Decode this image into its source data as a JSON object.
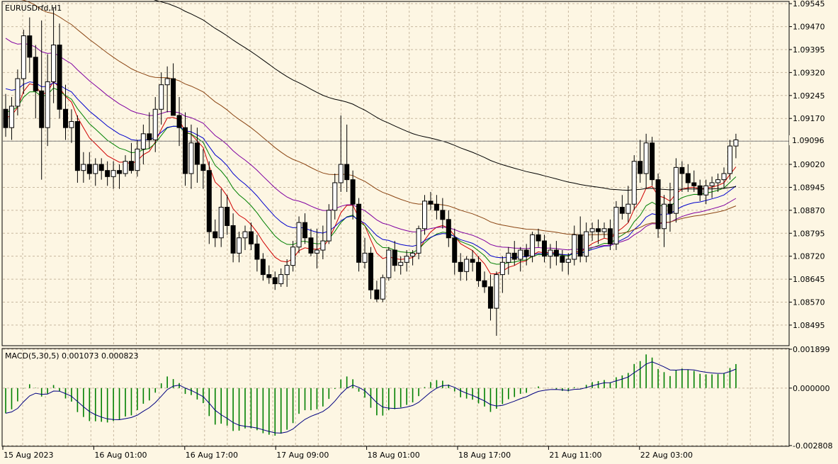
{
  "chart_data": {
    "type": "candlestick",
    "symbol_label": "EURUSDrfd,H1",
    "current_price_label": "1.09096",
    "current_price": 1.09096,
    "colors": {
      "background": "#fdf6e3",
      "grid": "#c8b8a0",
      "bull_body": "#ffffff",
      "bear_body": "#000000",
      "ema_fast": "#d00000",
      "ema_mid": "#008000",
      "ema_blue": "#0000cc",
      "ema_purple": "#8000a0",
      "ema_brown": "#8b4513",
      "ema_black": "#000000",
      "macd_hist": "#008000",
      "macd_signal": "#000080",
      "current_line": "#808080"
    },
    "price_axis": {
      "min": 1.0843,
      "max": 1.0955,
      "ticks": [
        "1.09545",
        "1.09470",
        "1.09395",
        "1.09320",
        "1.09245",
        "1.09170",
        "1.09020",
        "1.08945",
        "1.08870",
        "1.08795",
        "1.08720",
        "1.08645",
        "1.08570",
        "1.08495"
      ]
    },
    "time_labels": [
      "15 Aug 2023",
      "16 Aug 01:00",
      "16 Aug 17:00",
      "17 Aug 09:00",
      "18 Aug 01:00",
      "18 Aug 17:00",
      "21 Aug 11:00",
      "22 Aug 03:00"
    ],
    "macd": {
      "label": "MACD(5,30,5) 0.001073 0.000823",
      "axis_ticks": [
        "0.001899",
        "0.000000",
        "-0.002808"
      ],
      "min": -0.002808,
      "max": 0.001899
    },
    "candles": [
      [
        1.092,
        1.0925,
        1.0911,
        1.0914
      ],
      [
        1.0914,
        1.0924,
        1.091,
        1.0921
      ],
      [
        1.0921,
        1.0933,
        1.0918,
        1.093
      ],
      [
        1.093,
        1.0946,
        1.0925,
        1.0944
      ],
      [
        1.0944,
        1.095,
        1.0932,
        1.0937
      ],
      [
        1.0937,
        1.0941,
        1.0917,
        1.0926
      ],
      [
        1.0926,
        1.0949,
        1.0897,
        1.0914
      ],
      [
        1.0914,
        1.0938,
        1.0908,
        1.0929
      ],
      [
        1.0929,
        1.0953,
        1.0922,
        1.0941
      ],
      [
        1.0941,
        1.0948,
        1.0917,
        1.092
      ],
      [
        1.092,
        1.0928,
        1.091,
        1.0914
      ],
      [
        1.0914,
        1.092,
        1.0909,
        1.0916
      ],
      [
        1.0916,
        1.0918,
        1.0896,
        1.09
      ],
      [
        1.09,
        1.0906,
        1.0896,
        1.0902
      ],
      [
        1.0902,
        1.0906,
        1.0897,
        1.0899
      ],
      [
        1.0899,
        1.0904,
        1.0895,
        1.0902
      ],
      [
        1.0902,
        1.0904,
        1.0897,
        1.09
      ],
      [
        1.09,
        1.0903,
        1.0895,
        1.0898
      ],
      [
        1.0898,
        1.0903,
        1.0894,
        1.09
      ],
      [
        1.09,
        1.0902,
        1.0894,
        1.0899
      ],
      [
        1.0899,
        1.0905,
        1.0898,
        1.0903
      ],
      [
        1.0903,
        1.0909,
        1.0899,
        1.09
      ],
      [
        1.09,
        1.091,
        1.0898,
        1.0907
      ],
      [
        1.0907,
        1.0915,
        1.0902,
        1.0912
      ],
      [
        1.0912,
        1.0919,
        1.0907,
        1.091
      ],
      [
        1.091,
        1.0924,
        1.0906,
        1.092
      ],
      [
        1.092,
        1.0932,
        1.0915,
        1.0928
      ],
      [
        1.0928,
        1.0934,
        1.0919,
        1.093
      ],
      [
        1.093,
        1.0935,
        1.0918,
        1.0918
      ],
      [
        1.0918,
        1.0924,
        1.0908,
        1.0914
      ],
      [
        1.0914,
        1.0919,
        1.0895,
        1.0899
      ],
      [
        1.0899,
        1.0915,
        1.0894,
        1.0909
      ],
      [
        1.0909,
        1.0914,
        1.0896,
        1.0902
      ],
      [
        1.0902,
        1.0907,
        1.0894,
        1.09
      ],
      [
        1.09,
        1.0903,
        1.0876,
        1.088
      ],
      [
        1.088,
        1.0884,
        1.0875,
        1.0878
      ],
      [
        1.0878,
        1.0894,
        1.0875,
        1.0888
      ],
      [
        1.0888,
        1.0892,
        1.0879,
        1.0882
      ],
      [
        1.0882,
        1.0886,
        1.087,
        1.0873
      ],
      [
        1.0873,
        1.088,
        1.087,
        1.0878
      ],
      [
        1.0878,
        1.0882,
        1.0874,
        1.088
      ],
      [
        1.088,
        1.0883,
        1.0874,
        1.0876
      ],
      [
        1.0876,
        1.0879,
        1.0867,
        1.0871
      ],
      [
        1.0871,
        1.0873,
        1.0864,
        1.0866
      ],
      [
        1.0866,
        1.0869,
        1.0863,
        1.0865
      ],
      [
        1.0865,
        1.0867,
        1.0861,
        1.0863
      ],
      [
        1.0863,
        1.0868,
        1.0862,
        1.0866
      ],
      [
        1.0866,
        1.0871,
        1.0862,
        1.0869
      ],
      [
        1.0869,
        1.0877,
        1.0867,
        1.0875
      ],
      [
        1.0875,
        1.0885,
        1.0873,
        1.0883
      ],
      [
        1.0883,
        1.0886,
        1.0876,
        1.0878
      ],
      [
        1.0878,
        1.0881,
        1.0872,
        1.0873
      ],
      [
        1.0873,
        1.0881,
        1.0868,
        1.0874
      ],
      [
        1.0874,
        1.0882,
        1.0871,
        1.0877
      ],
      [
        1.0877,
        1.0889,
        1.0876,
        1.0887
      ],
      [
        1.0887,
        1.0899,
        1.0884,
        1.0896
      ],
      [
        1.0896,
        1.0918,
        1.0893,
        1.0902
      ],
      [
        1.0902,
        1.0915,
        1.0893,
        1.0897
      ],
      [
        1.0897,
        1.09,
        1.0884,
        1.0889
      ],
      [
        1.0889,
        1.0891,
        1.0867,
        1.087
      ],
      [
        1.087,
        1.0878,
        1.0868,
        1.0873
      ],
      [
        1.0873,
        1.0875,
        1.0858,
        1.0861
      ],
      [
        1.0861,
        1.0864,
        1.0857,
        1.0858
      ],
      [
        1.0858,
        1.0866,
        1.0857,
        1.0865
      ],
      [
        1.0865,
        1.0875,
        1.0864,
        1.0874
      ],
      [
        1.0874,
        1.0877,
        1.0867,
        1.0869
      ],
      [
        1.0869,
        1.0872,
        1.0866,
        1.087
      ],
      [
        1.087,
        1.0874,
        1.0867,
        1.0872
      ],
      [
        1.0872,
        1.0874,
        1.0869,
        1.0873
      ],
      [
        1.0873,
        1.0882,
        1.0871,
        1.0881
      ],
      [
        1.0881,
        1.0892,
        1.0879,
        1.089
      ],
      [
        1.089,
        1.0893,
        1.0887,
        1.0889
      ],
      [
        1.0889,
        1.0892,
        1.0884,
        1.0887
      ],
      [
        1.0887,
        1.0891,
        1.0881,
        1.0884
      ],
      [
        1.0884,
        1.0887,
        1.0875,
        1.0878
      ],
      [
        1.0878,
        1.0881,
        1.0866,
        1.087
      ],
      [
        1.087,
        1.0873,
        1.0864,
        1.0867
      ],
      [
        1.0867,
        1.0872,
        1.0864,
        1.0871
      ],
      [
        1.0871,
        1.0874,
        1.0867,
        1.087
      ],
      [
        1.087,
        1.0872,
        1.0862,
        1.0864
      ],
      [
        1.0864,
        1.0867,
        1.086,
        1.0862
      ],
      [
        1.0862,
        1.0866,
        1.0851,
        1.0855
      ],
      [
        1.0855,
        1.0867,
        1.0846,
        1.0866
      ],
      [
        1.0866,
        1.0872,
        1.086,
        1.087
      ],
      [
        1.087,
        1.0875,
        1.0866,
        1.0873
      ],
      [
        1.0873,
        1.0877,
        1.0869,
        1.0871
      ],
      [
        1.0871,
        1.0875,
        1.0867,
        1.0874
      ],
      [
        1.0874,
        1.0876,
        1.0869,
        1.0872
      ],
      [
        1.0872,
        1.088,
        1.087,
        1.0879
      ],
      [
        1.0879,
        1.0881,
        1.0875,
        1.0877
      ],
      [
        1.0877,
        1.0879,
        1.087,
        1.0872
      ],
      [
        1.0872,
        1.0876,
        1.0868,
        1.0874
      ],
      [
        1.0874,
        1.0877,
        1.0869,
        1.0872
      ],
      [
        1.0872,
        1.0874,
        1.0867,
        1.087
      ],
      [
        1.087,
        1.0873,
        1.0866,
        1.0871
      ],
      [
        1.0871,
        1.0882,
        1.0869,
        1.0879
      ],
      [
        1.0879,
        1.0885,
        1.087,
        1.0872
      ],
      [
        1.0872,
        1.0883,
        1.087,
        1.088
      ],
      [
        1.088,
        1.0883,
        1.0877,
        1.0881
      ],
      [
        1.0881,
        1.0884,
        1.0876,
        1.088
      ],
      [
        1.088,
        1.0883,
        1.0878,
        1.0881
      ],
      [
        1.0881,
        1.0884,
        1.0874,
        1.0876
      ],
      [
        1.0876,
        1.089,
        1.0874,
        1.0888
      ],
      [
        1.0888,
        1.0892,
        1.0884,
        1.0886
      ],
      [
        1.0886,
        1.0895,
        1.0883,
        1.0889
      ],
      [
        1.0889,
        1.0905,
        1.0887,
        1.0903
      ],
      [
        1.0903,
        1.091,
        1.0896,
        1.0899
      ],
      [
        1.0899,
        1.0912,
        1.0894,
        1.0909
      ],
      [
        1.0909,
        1.0911,
        1.0895,
        1.0897
      ],
      [
        1.0897,
        1.0899,
        1.0878,
        1.0881
      ],
      [
        1.0881,
        1.0892,
        1.0875,
        1.0889
      ],
      [
        1.0889,
        1.0896,
        1.088,
        1.0886
      ],
      [
        1.0886,
        1.0904,
        1.0883,
        1.0901
      ],
      [
        1.0901,
        1.0903,
        1.0893,
        1.0899
      ],
      [
        1.0899,
        1.0902,
        1.0893,
        1.0896
      ],
      [
        1.0896,
        1.09,
        1.0893,
        1.0895
      ],
      [
        1.0895,
        1.0897,
        1.089,
        1.0892
      ],
      [
        1.0892,
        1.0897,
        1.0889,
        1.0895
      ],
      [
        1.0895,
        1.0898,
        1.0891,
        1.0896
      ],
      [
        1.0896,
        1.0899,
        1.0893,
        1.0897
      ],
      [
        1.0897,
        1.0901,
        1.0894,
        1.0899
      ],
      [
        1.0899,
        1.091,
        1.0897,
        1.0908
      ],
      [
        1.0908,
        1.0912,
        1.0904,
        1.091
      ]
    ]
  }
}
